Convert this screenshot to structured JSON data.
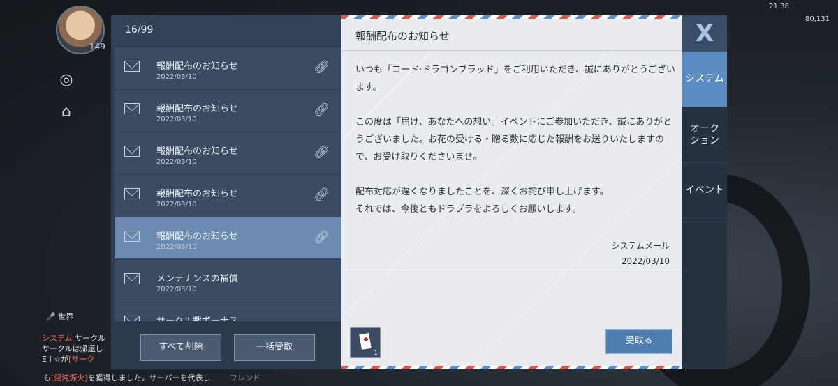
{
  "hud": {
    "level": "149",
    "clock": "21:38",
    "money": "80,131",
    "world_label": "世界",
    "chat": {
      "line1_tag": "システム",
      "line1_text": "サークル",
      "line2": "サークルは帰還し",
      "line3_prefix": "E I ☆が",
      "line3_tag": "[サーク",
      "bottom_tag": "[混沌源火]",
      "bottom_text": "を獲得しました。サーバーを代表し",
      "bottom_prefix": "も",
      "friend": "フレンド"
    }
  },
  "mailbox": {
    "count": "16/99",
    "items": [
      {
        "subject": "報酬配布のお知らせ",
        "date": "2022/03/10"
      },
      {
        "subject": "報酬配布のお知らせ",
        "date": "2022/03/10"
      },
      {
        "subject": "報酬配布のお知らせ",
        "date": "2022/03/10"
      },
      {
        "subject": "報酬配布のお知らせ",
        "date": "2022/03/10"
      },
      {
        "subject": "報酬配布のお知らせ",
        "date": "2022/03/10"
      },
      {
        "subject": "メンテナンスの補償",
        "date": "2022/03/10"
      },
      {
        "subject": "サークル戦ボーナス",
        "date": ""
      }
    ],
    "selected_index": 4,
    "delete_all_label": "すべて削除",
    "receive_all_label": "一括受取"
  },
  "message": {
    "title": "報酬配布のお知らせ",
    "paragraph1": "いつも「コード·ドラゴンブラッド」をご利用いただき、誠にありがとうございます。",
    "paragraph2": "この度は「届け、あなたへの想い」イベントにご参加いただき、誠にありがとうございました。お花の受ける・贈る数に応じた報酬をお送りいたしますので、お受け取りくださいませ。",
    "paragraph3_line1": "配布対応が遅くなりましたことを、深くお詫び申し上げます。",
    "paragraph3_line2": "それでは、今後ともドラブラをよろしくお願いします。",
    "sender": "システムメール",
    "date": "2022/03/10",
    "attachment_qty": "1",
    "receive_label": "受取る"
  },
  "tabs": {
    "close_glyph": "X",
    "items": [
      {
        "label": "システム"
      },
      {
        "label": "オーク\nション"
      },
      {
        "label": "イベント"
      }
    ]
  }
}
